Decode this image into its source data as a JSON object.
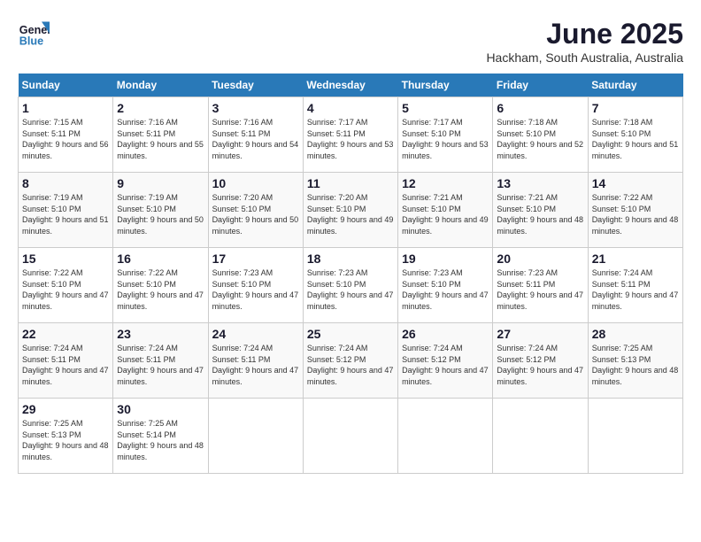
{
  "logo": {
    "text_general": "General",
    "text_blue": "Blue"
  },
  "title": "June 2025",
  "location": "Hackham, South Australia, Australia",
  "days_of_week": [
    "Sunday",
    "Monday",
    "Tuesday",
    "Wednesday",
    "Thursday",
    "Friday",
    "Saturday"
  ],
  "weeks": [
    [
      {
        "day": "1",
        "sunrise": "Sunrise: 7:15 AM",
        "sunset": "Sunset: 5:11 PM",
        "daylight": "Daylight: 9 hours and 56 minutes."
      },
      {
        "day": "2",
        "sunrise": "Sunrise: 7:16 AM",
        "sunset": "Sunset: 5:11 PM",
        "daylight": "Daylight: 9 hours and 55 minutes."
      },
      {
        "day": "3",
        "sunrise": "Sunrise: 7:16 AM",
        "sunset": "Sunset: 5:11 PM",
        "daylight": "Daylight: 9 hours and 54 minutes."
      },
      {
        "day": "4",
        "sunrise": "Sunrise: 7:17 AM",
        "sunset": "Sunset: 5:11 PM",
        "daylight": "Daylight: 9 hours and 53 minutes."
      },
      {
        "day": "5",
        "sunrise": "Sunrise: 7:17 AM",
        "sunset": "Sunset: 5:10 PM",
        "daylight": "Daylight: 9 hours and 53 minutes."
      },
      {
        "day": "6",
        "sunrise": "Sunrise: 7:18 AM",
        "sunset": "Sunset: 5:10 PM",
        "daylight": "Daylight: 9 hours and 52 minutes."
      },
      {
        "day": "7",
        "sunrise": "Sunrise: 7:18 AM",
        "sunset": "Sunset: 5:10 PM",
        "daylight": "Daylight: 9 hours and 51 minutes."
      }
    ],
    [
      {
        "day": "8",
        "sunrise": "Sunrise: 7:19 AM",
        "sunset": "Sunset: 5:10 PM",
        "daylight": "Daylight: 9 hours and 51 minutes."
      },
      {
        "day": "9",
        "sunrise": "Sunrise: 7:19 AM",
        "sunset": "Sunset: 5:10 PM",
        "daylight": "Daylight: 9 hours and 50 minutes."
      },
      {
        "day": "10",
        "sunrise": "Sunrise: 7:20 AM",
        "sunset": "Sunset: 5:10 PM",
        "daylight": "Daylight: 9 hours and 50 minutes."
      },
      {
        "day": "11",
        "sunrise": "Sunrise: 7:20 AM",
        "sunset": "Sunset: 5:10 PM",
        "daylight": "Daylight: 9 hours and 49 minutes."
      },
      {
        "day": "12",
        "sunrise": "Sunrise: 7:21 AM",
        "sunset": "Sunset: 5:10 PM",
        "daylight": "Daylight: 9 hours and 49 minutes."
      },
      {
        "day": "13",
        "sunrise": "Sunrise: 7:21 AM",
        "sunset": "Sunset: 5:10 PM",
        "daylight": "Daylight: 9 hours and 48 minutes."
      },
      {
        "day": "14",
        "sunrise": "Sunrise: 7:22 AM",
        "sunset": "Sunset: 5:10 PM",
        "daylight": "Daylight: 9 hours and 48 minutes."
      }
    ],
    [
      {
        "day": "15",
        "sunrise": "Sunrise: 7:22 AM",
        "sunset": "Sunset: 5:10 PM",
        "daylight": "Daylight: 9 hours and 47 minutes."
      },
      {
        "day": "16",
        "sunrise": "Sunrise: 7:22 AM",
        "sunset": "Sunset: 5:10 PM",
        "daylight": "Daylight: 9 hours and 47 minutes."
      },
      {
        "day": "17",
        "sunrise": "Sunrise: 7:23 AM",
        "sunset": "Sunset: 5:10 PM",
        "daylight": "Daylight: 9 hours and 47 minutes."
      },
      {
        "day": "18",
        "sunrise": "Sunrise: 7:23 AM",
        "sunset": "Sunset: 5:10 PM",
        "daylight": "Daylight: 9 hours and 47 minutes."
      },
      {
        "day": "19",
        "sunrise": "Sunrise: 7:23 AM",
        "sunset": "Sunset: 5:10 PM",
        "daylight": "Daylight: 9 hours and 47 minutes."
      },
      {
        "day": "20",
        "sunrise": "Sunrise: 7:23 AM",
        "sunset": "Sunset: 5:11 PM",
        "daylight": "Daylight: 9 hours and 47 minutes."
      },
      {
        "day": "21",
        "sunrise": "Sunrise: 7:24 AM",
        "sunset": "Sunset: 5:11 PM",
        "daylight": "Daylight: 9 hours and 47 minutes."
      }
    ],
    [
      {
        "day": "22",
        "sunrise": "Sunrise: 7:24 AM",
        "sunset": "Sunset: 5:11 PM",
        "daylight": "Daylight: 9 hours and 47 minutes."
      },
      {
        "day": "23",
        "sunrise": "Sunrise: 7:24 AM",
        "sunset": "Sunset: 5:11 PM",
        "daylight": "Daylight: 9 hours and 47 minutes."
      },
      {
        "day": "24",
        "sunrise": "Sunrise: 7:24 AM",
        "sunset": "Sunset: 5:11 PM",
        "daylight": "Daylight: 9 hours and 47 minutes."
      },
      {
        "day": "25",
        "sunrise": "Sunrise: 7:24 AM",
        "sunset": "Sunset: 5:12 PM",
        "daylight": "Daylight: 9 hours and 47 minutes."
      },
      {
        "day": "26",
        "sunrise": "Sunrise: 7:24 AM",
        "sunset": "Sunset: 5:12 PM",
        "daylight": "Daylight: 9 hours and 47 minutes."
      },
      {
        "day": "27",
        "sunrise": "Sunrise: 7:24 AM",
        "sunset": "Sunset: 5:12 PM",
        "daylight": "Daylight: 9 hours and 47 minutes."
      },
      {
        "day": "28",
        "sunrise": "Sunrise: 7:25 AM",
        "sunset": "Sunset: 5:13 PM",
        "daylight": "Daylight: 9 hours and 48 minutes."
      }
    ],
    [
      {
        "day": "29",
        "sunrise": "Sunrise: 7:25 AM",
        "sunset": "Sunset: 5:13 PM",
        "daylight": "Daylight: 9 hours and 48 minutes."
      },
      {
        "day": "30",
        "sunrise": "Sunrise: 7:25 AM",
        "sunset": "Sunset: 5:14 PM",
        "daylight": "Daylight: 9 hours and 48 minutes."
      },
      null,
      null,
      null,
      null,
      null
    ]
  ]
}
